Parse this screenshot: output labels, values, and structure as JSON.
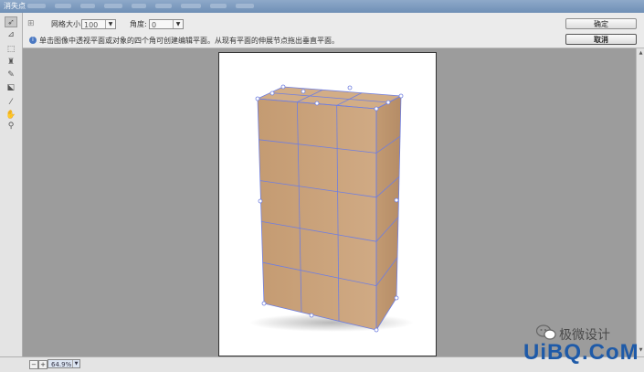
{
  "window": {
    "title": "消失点"
  },
  "options": {
    "grid_label": "网格大小:",
    "grid_value": "100",
    "angle_label": "角度:",
    "angle_value": "0",
    "ok_label": "确定",
    "cancel_label": "取消",
    "hint": "单击图像中透视平面或对象的四个角可创建编辑平面。从现有平面的伸展节点拖出垂直平面。"
  },
  "status": {
    "zoom": "64.9%"
  },
  "watermark": {
    "cn_text": "极微设计",
    "logo_text": "UiBQ.CoM"
  },
  "colors": {
    "grid_line": "#6f7ee0",
    "box_face": "#c9a27b",
    "box_side": "#bf9670",
    "box_top": "#d2ad86"
  },
  "icons": {
    "tools": [
      "edit-plane-icon",
      "create-plane-icon",
      "marquee-icon",
      "stamp-icon",
      "brush-icon",
      "transform-icon",
      "eyedropper-icon",
      "hand-icon",
      "zoom-icon"
    ]
  }
}
